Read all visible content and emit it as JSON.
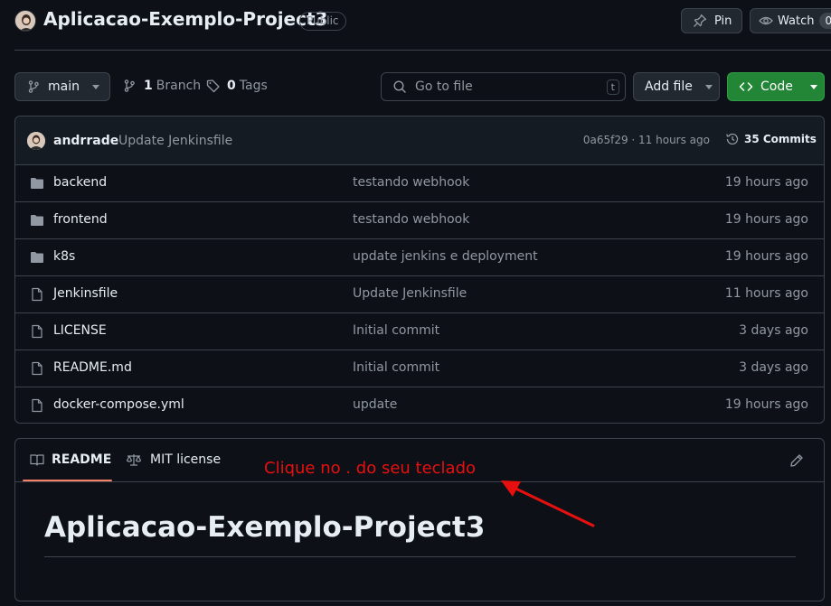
{
  "repo": {
    "title": "Aplicacao-Exemplo-Project3",
    "visibility": "Public",
    "pin_label": "Pin",
    "watch_label": "Watch",
    "watch_count": "0"
  },
  "toolbar": {
    "branch_name": "main",
    "branch_count": "1",
    "branch_label": "Branch",
    "tag_count": "0",
    "tag_label": "Tags",
    "search_placeholder": "Go to file",
    "search_shortcut": "t",
    "add_file_label": "Add file",
    "code_label": "Code",
    "code_color": "#238636"
  },
  "latest_commit": {
    "author": "andrrade",
    "message": "Update Jenkinsfile",
    "hash_time": "0a65f29 · 11 hours ago",
    "commits_label": "35 Commits"
  },
  "files": [
    {
      "name": "backend",
      "type": "folder",
      "commit": "testando webhook",
      "date": "19 hours ago"
    },
    {
      "name": "frontend",
      "type": "folder",
      "commit": "testando webhook",
      "date": "19 hours ago"
    },
    {
      "name": "k8s",
      "type": "folder",
      "commit": "update jenkins e deployment",
      "date": "19 hours ago"
    },
    {
      "name": "Jenkinsfile",
      "type": "file",
      "commit": "Update Jenkinsfile",
      "date": "11 hours ago"
    },
    {
      "name": "LICENSE",
      "type": "file",
      "commit": "Initial commit",
      "date": "3 days ago"
    },
    {
      "name": "README.md",
      "type": "file",
      "commit": "Initial commit",
      "date": "3 days ago"
    },
    {
      "name": "docker-compose.yml",
      "type": "file",
      "commit": "update",
      "date": "19 hours ago"
    }
  ],
  "readme": {
    "tab_readme": "README",
    "tab_license": "MIT license",
    "heading": "Aplicacao-Exemplo-Project3"
  },
  "annotation": {
    "text": "Clique no . do seu teclado",
    "color": "#e8100f"
  }
}
